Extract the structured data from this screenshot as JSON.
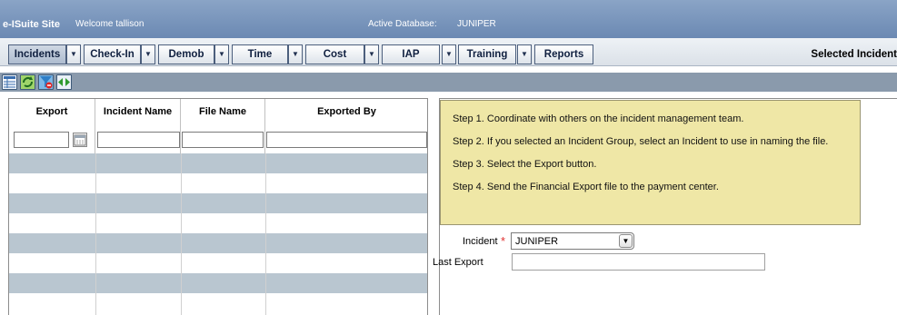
{
  "header": {
    "app_title": "e-ISuite Site",
    "welcome": "Welcome tallison",
    "db_label": "Active Database:",
    "db_value": "JUNIPER"
  },
  "menu": {
    "items": [
      {
        "label": "Incidents",
        "active": true
      },
      {
        "label": "Check-In"
      },
      {
        "label": "Demob"
      },
      {
        "label": "Time"
      },
      {
        "label": "Cost"
      },
      {
        "label": "IAP"
      },
      {
        "label": "Training"
      },
      {
        "label": "Reports"
      }
    ],
    "dropdown_glyph": "▼",
    "selected_incident_label": "Selected Incident"
  },
  "toolbar": {
    "icons": [
      "grid-icon",
      "refresh-icon",
      "filter-clear-icon",
      "expand-icon"
    ]
  },
  "grid": {
    "columns": [
      "Export",
      "Incident Name",
      "File Name",
      "Exported By"
    ],
    "rows": [
      {
        "alt": true
      },
      {
        "alt": false
      },
      {
        "alt": true
      },
      {
        "alt": false
      },
      {
        "alt": true
      },
      {
        "alt": false
      },
      {
        "alt": true
      },
      {
        "alt": false
      }
    ]
  },
  "instructions": {
    "steps": [
      "Step 1. Coordinate with others on the incident management team.",
      "Step 2. If you selected an Incident Group, select an Incident to use in naming the file.",
      "Step 3. Select the Export button.",
      "Step 4. Send the Financial Export file to the payment center."
    ]
  },
  "form": {
    "incident_label": "Incident",
    "required_mark": "*",
    "incident_value": "JUNIPER",
    "last_export_label": "Last Export",
    "last_export_value": ""
  }
}
